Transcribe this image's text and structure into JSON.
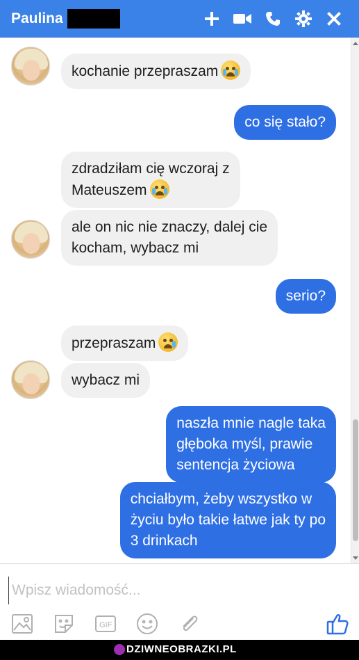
{
  "header": {
    "contact_name": "Paulina",
    "actions": [
      "add-icon",
      "video-call-icon",
      "phone-icon",
      "settings-icon",
      "close-icon"
    ],
    "bg_color": "#3b82e8"
  },
  "messages": [
    {
      "from": "them",
      "text": "kochanie przepraszam",
      "emoji": "crying-face"
    },
    {
      "from": "me",
      "text": "co się stało?"
    },
    {
      "from": "them",
      "lines": [
        "zdradziłam cię wczoraj z",
        "Mateuszem"
      ],
      "emoji": "crying-face"
    },
    {
      "from": "them",
      "lines": [
        "ale on nic nie znaczy, dalej cie",
        "kocham, wybacz mi"
      ]
    },
    {
      "from": "me",
      "text": "serio?"
    },
    {
      "from": "them",
      "text": "przepraszam",
      "emoji": "sad-tear-face"
    },
    {
      "from": "them",
      "text": "wybacz mi"
    },
    {
      "from": "me",
      "lines": [
        "naszła mnie nagle taka",
        "głęboka myśl, prawie",
        "sentencja życiowa"
      ]
    },
    {
      "from": "me",
      "lines": [
        "chciałbym, żeby wszystko w",
        "życiu było takie łatwe jak ty po",
        "3 drinkach"
      ]
    }
  ],
  "composer": {
    "placeholder": "Wpisz wiadomość...",
    "tools": [
      "image-icon",
      "sticker-icon",
      "gif-icon",
      "emoji-icon",
      "attachment-icon"
    ],
    "like_icon": "thumbs-up-icon"
  },
  "colors": {
    "outgoing_bubble": "#2f6fe4",
    "incoming_bubble": "#f1f0f0"
  },
  "watermark": "DZIWNEOBRAZKI.PL"
}
